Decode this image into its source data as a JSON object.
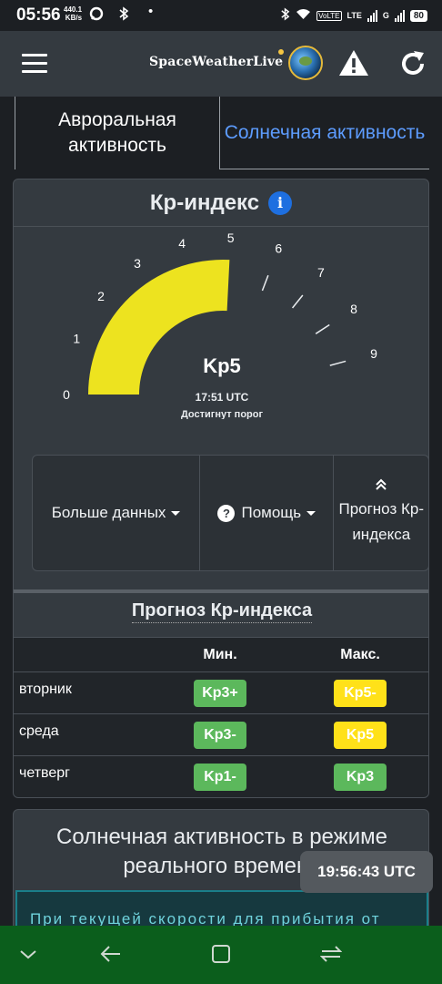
{
  "status_bar": {
    "time": "05:56",
    "speed_value": "440.1",
    "speed_unit": "KB/s",
    "lte_label": "VoLTE",
    "net_label": "LTE",
    "net2_label": "G",
    "battery": "80"
  },
  "header": {
    "brand": "SpaceWeatherLive"
  },
  "tabs": [
    {
      "label": "Авроральная активность",
      "active": true
    },
    {
      "label": "Солнечная активность",
      "active": false
    }
  ],
  "kp": {
    "title": "Кр-индекс",
    "info_icon": "i",
    "value": "Kp5",
    "time": "17:51 UTC",
    "status": "Достигнут порог",
    "gauge_ticks": [
      "0",
      "1",
      "2",
      "3",
      "4",
      "5",
      "6",
      "7",
      "8",
      "9"
    ],
    "gauge_value": 5,
    "gauge_max": 9,
    "gauge_color": "#ede31f"
  },
  "buttons": {
    "more_data": "Больше данных",
    "help_icon": "?",
    "help": "Помощь",
    "forecast": "Прогноз Кр-индекса"
  },
  "forecast": {
    "title": "Прогноз Кр-индекса",
    "col_min": "Мин.",
    "col_max": "Макс.",
    "rows": [
      {
        "day": "вторник",
        "min": "Kp3+",
        "min_color": "green",
        "max": "Kp5-",
        "max_color": "yellow"
      },
      {
        "day": "среда",
        "min": "Kp3-",
        "min_color": "green",
        "max": "Kp5",
        "max_color": "yellow"
      },
      {
        "day": "четверг",
        "min": "Kp1-",
        "min_color": "green",
        "max": "Kp3",
        "max_color": "green"
      }
    ]
  },
  "solar": {
    "title": "Солнечная активность в режиме реального времени",
    "text": "При текущей скорости для прибытия от"
  },
  "utc_clock": "19:56:43 UTC",
  "colors": {
    "accent_blue": "#5d9cff",
    "green_badge": "#5cb85c",
    "yellow_badge": "#ffe119",
    "nav_bar": "#0b5e1c"
  }
}
